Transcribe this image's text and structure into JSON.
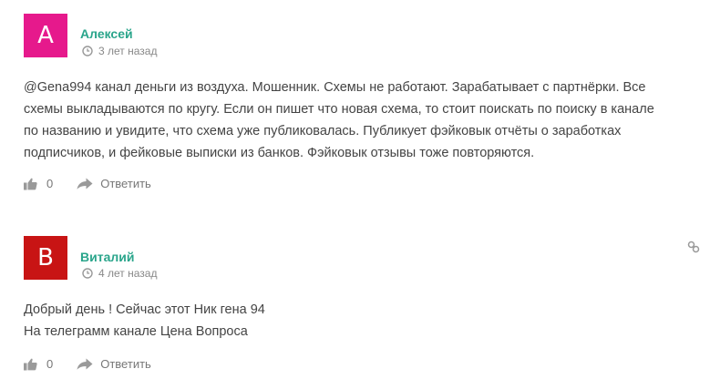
{
  "comments": [
    {
      "avatar_letter": "A",
      "avatar_color": "#e6198c",
      "author": "Алексей",
      "time": "3 лет назад",
      "lines": [
        "@Gena994 канал деньги из воздуха. Мошенник. Схемы не работают. Зарабатывает с партнёрки. Все",
        "схемы выкладываются по кругу. Если он пишет что новая схема, то стоит поискать по поиску в канале",
        "по названию и увидите, что схема уже публиковалась. Публикует фэйковык отчёты о заработках",
        "подписчиков, и фейковые выписки из банков. Фэйковык отзывы тоже повторяются."
      ],
      "likes": "0",
      "reply_label": "Ответить",
      "like_icon": "thumbs-up-icon",
      "reply_icon": "reply-arrow-icon"
    },
    {
      "avatar_letter": "B",
      "avatar_color": "#c81414",
      "author": "Виталий",
      "time": "4 лет назад",
      "lines": [
        "Добрый день ! Сейчас этот Ник гена 94",
        "На телеграмм канале Цена Вопроса"
      ],
      "likes": "0",
      "reply_label": "Ответить",
      "like_icon": "thumbs-up-icon",
      "reply_icon": "reply-arrow-icon"
    }
  ],
  "colors": {
    "author": "#2aa58b",
    "meta": "#888888",
    "text": "#444444",
    "actions": "#777777"
  }
}
